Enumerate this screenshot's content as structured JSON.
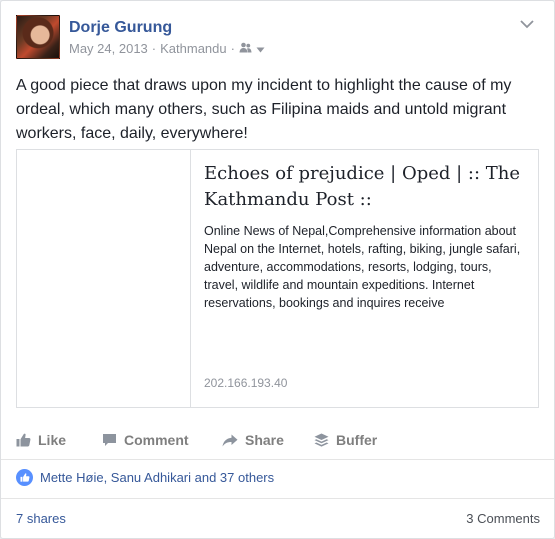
{
  "post": {
    "author": "Dorje Gurung",
    "date": "May 24, 2013",
    "location": "Kathmandu",
    "separator": "·",
    "text": "A good piece that draws upon my incident to highlight the cause of my ordeal, which many others, such as Filipina maids and untold migrant workers, face, daily, everywhere!"
  },
  "link": {
    "title": "Echoes of prejudice | Oped | :: The Kathmandu Post ::",
    "description": "Online News of Nepal,Comprehensive information about Nepal on the Internet, hotels, rafting, biking, jungle safari, adventure, accommodations, resorts, lodging, tours, travel, wildlife and mountain expeditions. Internet reservations, bookings and inquires receive",
    "domain": "202.166.193.40"
  },
  "actions": {
    "like": "Like",
    "comment": "Comment",
    "share": "Share",
    "buffer": "Buffer"
  },
  "stats": {
    "likers": "Mette Høie, Sanu Adhikari and 37 others",
    "shares": "7 shares",
    "comments": "3 Comments"
  },
  "icons": {
    "privacy": "friends-icon",
    "menu": "chevron-down-icon",
    "like": "thumbs-up-icon",
    "comment": "comment-icon",
    "share": "share-arrow-icon",
    "buffer": "buffer-stack-icon"
  },
  "colors": {
    "link_blue": "#365899",
    "muted": "#90949c",
    "action_gray": "#7f7f7f",
    "like_badge": "#5890ff"
  }
}
